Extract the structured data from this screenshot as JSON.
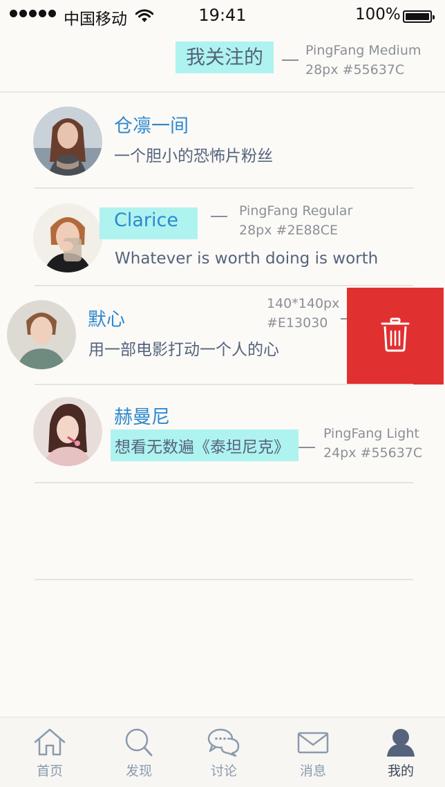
{
  "status_bar": {
    "carrier": "中国移动",
    "time": "19:41",
    "battery": "100%"
  },
  "nav": {
    "title": "我关注的"
  },
  "annotations": {
    "title_font": "PingFang Medium",
    "title_spec": "28px #55637C",
    "name_font": "PingFang Regular",
    "name_spec": "28px #2E88CE",
    "delete_size": "140*140px",
    "delete_color": "#E13030",
    "desc_font": "PingFang Light",
    "desc_spec": "24px #55637C"
  },
  "following": [
    {
      "name": "仓凛一间",
      "desc": "一个胆小的恐怖片粉丝"
    },
    {
      "name": "Clarice",
      "desc": "Whatever is worth doing is worth"
    },
    {
      "name": "默心",
      "desc": "用一部电影打动一个人的心"
    },
    {
      "name": "赫曼尼",
      "desc": "想看无数遍《泰坦尼克》"
    }
  ],
  "tabs": [
    {
      "label": "首页",
      "icon": "home-icon"
    },
    {
      "label": "发现",
      "icon": "search-icon"
    },
    {
      "label": "讨论",
      "icon": "chat-bubbles-icon"
    },
    {
      "label": "消息",
      "icon": "mail-icon"
    },
    {
      "label": "我的",
      "icon": "user-icon",
      "active": true
    }
  ],
  "colors": {
    "title": "#55637C",
    "name": "#2E88CE",
    "desc": "#55637C",
    "delete": "#E13030",
    "highlight": "#AEF3EF"
  }
}
